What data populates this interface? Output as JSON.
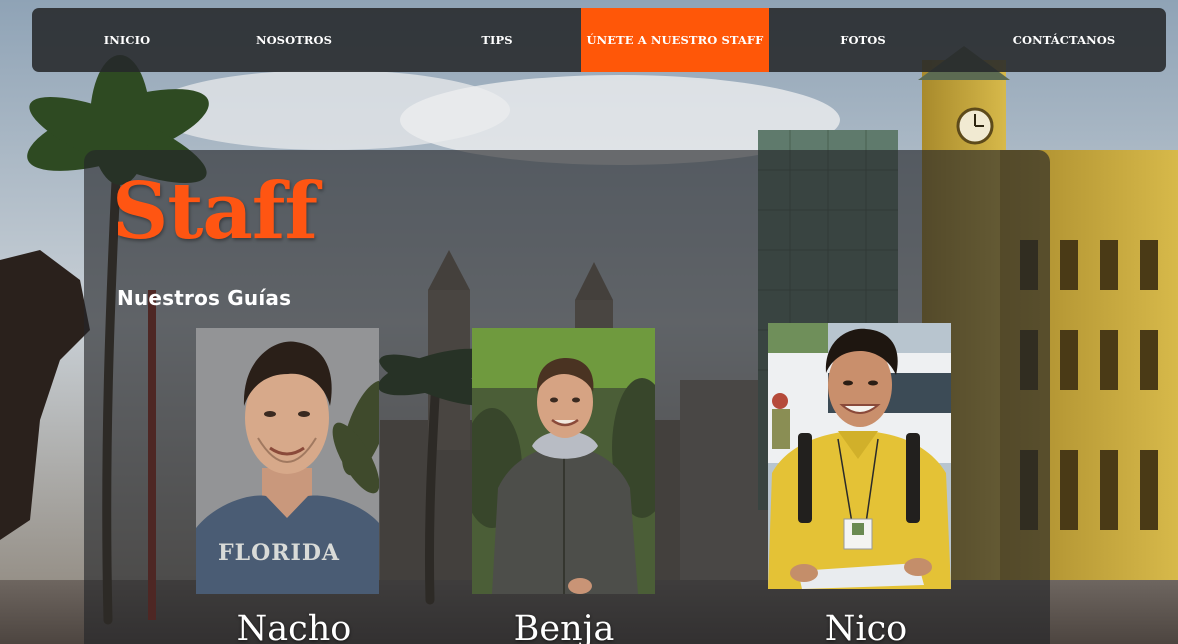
{
  "nav": {
    "items": [
      {
        "label": "INICIO",
        "active": false
      },
      {
        "label": "NOSOTROS",
        "active": false
      },
      {
        "label": "TIPS",
        "active": false
      },
      {
        "label": "ÚNETE A NUESTRO STAFF",
        "active": true
      },
      {
        "label": "FOTOS",
        "active": false
      },
      {
        "label": "CONTÁCTANOS",
        "active": false
      }
    ]
  },
  "section": {
    "title": "Staff",
    "subtitle": "Nuestros Guías"
  },
  "guides": [
    {
      "name": "Nacho",
      "shirt_text": "FLORIDA",
      "photo_icon": "guide-photo-nacho"
    },
    {
      "name": "Benja",
      "photo_icon": "guide-photo-benja"
    },
    {
      "name": "Nico",
      "photo_icon": "guide-photo-nico"
    }
  ],
  "colors": {
    "accent": "#ff5708",
    "nav_background": "#26282a",
    "panel_overlay": "#242628"
  }
}
